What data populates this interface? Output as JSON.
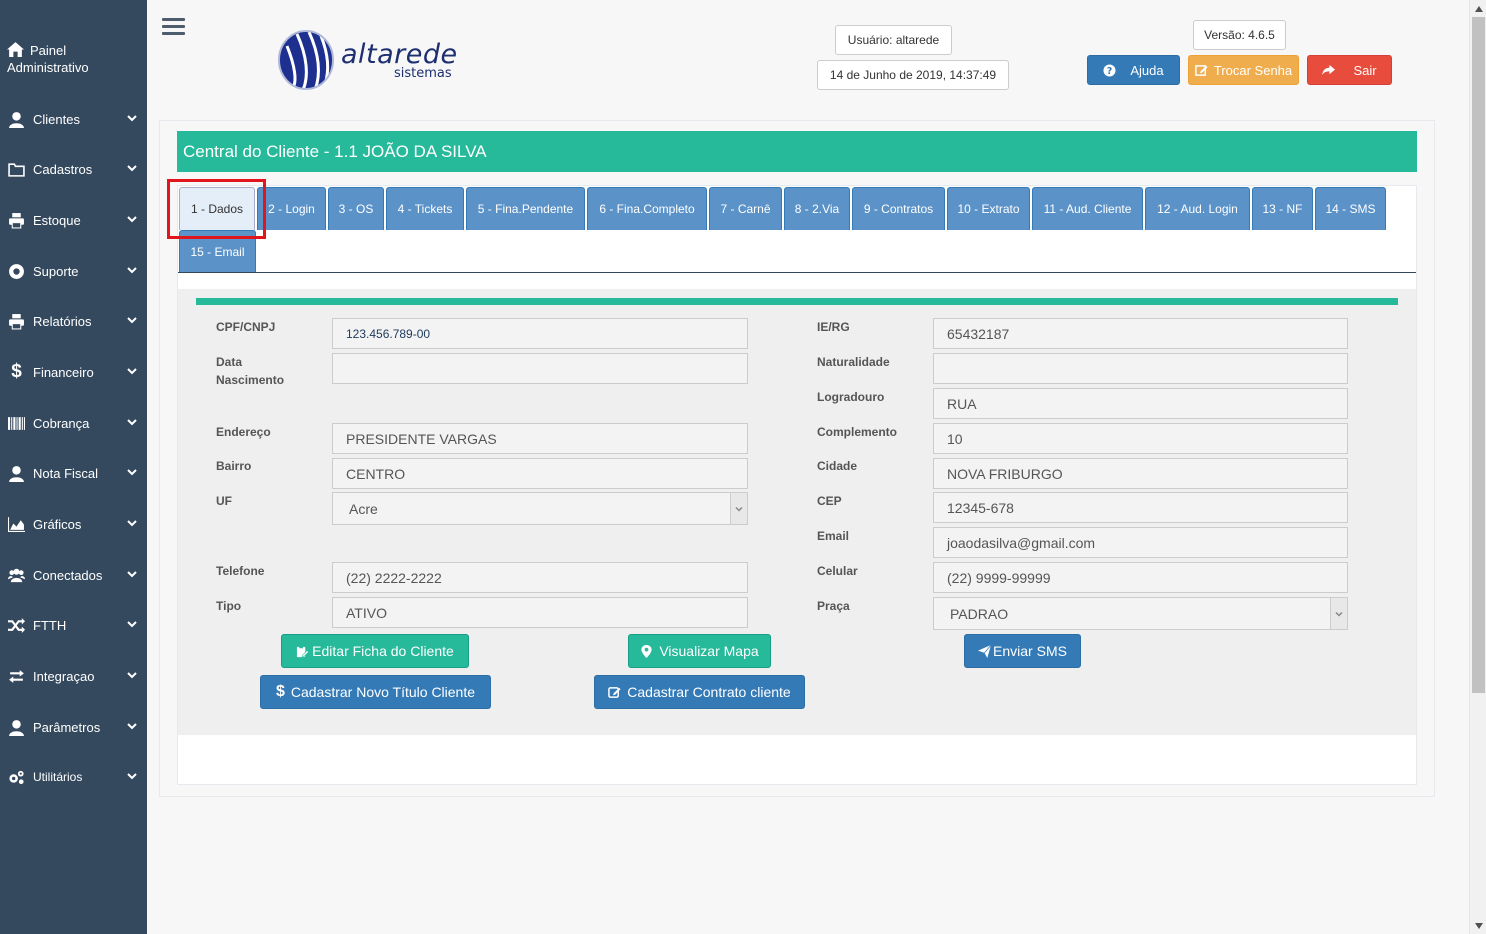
{
  "sidebar": {
    "header": "Painel Administrativo",
    "items": [
      {
        "label": "Clientes",
        "icon": "user-icon"
      },
      {
        "label": "Cadastros",
        "icon": "folder-icon"
      },
      {
        "label": "Estoque",
        "icon": "printer-icon"
      },
      {
        "label": "Suporte",
        "icon": "lifebuoy-icon"
      },
      {
        "label": "Relatórios",
        "icon": "printer-icon"
      },
      {
        "label": "Financeiro",
        "icon": "dollar-icon"
      },
      {
        "label": "Cobrança",
        "icon": "barcode-icon"
      },
      {
        "label": "Nota Fiscal",
        "icon": "user-icon"
      },
      {
        "label": "Gráficos",
        "icon": "area-chart-icon"
      },
      {
        "label": "Conectados",
        "icon": "users-icon"
      },
      {
        "label": "FTTH",
        "icon": "random-icon"
      },
      {
        "label": "Integraçao",
        "icon": "exchange-icon"
      },
      {
        "label": "Parâmetros",
        "icon": "user-icon"
      },
      {
        "label": "Utilitários",
        "icon": "cogs-icon"
      }
    ]
  },
  "header": {
    "logo_text": "altarede",
    "logo_sub": "sistemas",
    "user": "Usuário: altarede",
    "datetime": "14 de Junho de 2019, 14:37:49",
    "version": "Versão: 4.6.5",
    "help_label": "Ajuda",
    "change_password_label": "Trocar Senha",
    "logout_label": "Sair"
  },
  "panel": {
    "title": "Central do Cliente - 1.1 JOÃO DA SILVA"
  },
  "tabs": [
    "1 - Dados",
    "2 - Login",
    "3 - OS",
    "4 - Tickets",
    "5 - Fina.Pendente",
    "6 - Fina.Completo",
    "7 - Carnê",
    "8 - 2.Via",
    "9 - Contratos",
    "10 - Extrato",
    "11 - Aud. Cliente",
    "12 - Aud. Login",
    "13 - NF",
    "14 - SMS",
    "15 - Email"
  ],
  "form": {
    "left": [
      {
        "label": "CPF/CNPJ",
        "value": "123.456.789-00"
      },
      {
        "label": "Data Nascimento",
        "value": ""
      },
      {
        "label": "Endereço",
        "value": "PRESIDENTE VARGAS"
      },
      {
        "label": "Bairro",
        "value": "CENTRO"
      },
      {
        "label": "UF",
        "value": "Acre"
      },
      {
        "label": "Telefone",
        "value": "(22) 2222-2222"
      },
      {
        "label": "Tipo",
        "value": "ATIVO"
      }
    ],
    "right": [
      {
        "label": "IE/RG",
        "value": "65432187"
      },
      {
        "label": "Naturalidade",
        "value": ""
      },
      {
        "label": "Logradouro",
        "value": "RUA"
      },
      {
        "label": "Complemento",
        "value": "10"
      },
      {
        "label": "Cidade",
        "value": "NOVA FRIBURGO"
      },
      {
        "label": "CEP",
        "value": "12345-678"
      },
      {
        "label": "Email",
        "value": "joaodasilva@gmail.com"
      },
      {
        "label": "Celular",
        "value": "(22) 9999-99999"
      },
      {
        "label": "Praça",
        "value": "PADRAO"
      }
    ]
  },
  "actions": {
    "edit": "Editar Ficha do Cliente",
    "map": "Visualizar Mapa",
    "sms": "Enviar SMS",
    "new_title": "Cadastrar Novo Título Cliente",
    "new_contract": "Cadastrar Contrato cliente"
  },
  "colors": {
    "sidebar": "#34495e",
    "accent_green": "#26b99a",
    "tab_blue": "#5b92c8",
    "highlight_red": "#e2151c"
  }
}
